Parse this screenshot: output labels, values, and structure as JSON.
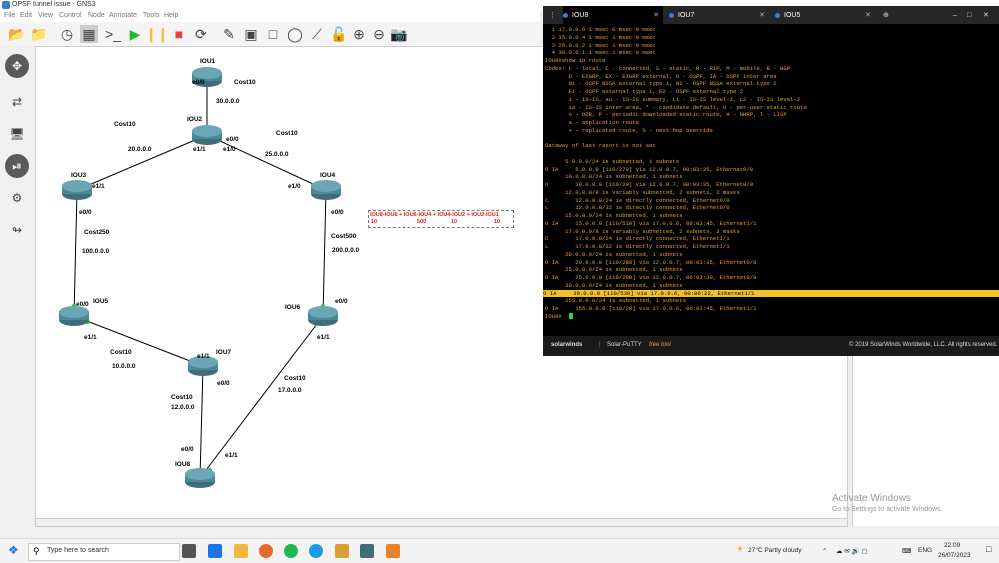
{
  "window": {
    "title": "OPSF tunnel issue - GNS3"
  },
  "menu": [
    "File",
    "Edit",
    "View",
    "Control",
    "Node",
    "Annotate",
    "Tools",
    "Help"
  ],
  "topology": {
    "routers": [
      "IOU1",
      "IOU2",
      "IOU3",
      "IOU4",
      "IOU5",
      "IOU6",
      "IOU7",
      "IOU8"
    ],
    "ports": {
      "iou1_e00": "e0/0",
      "iou2_e11": "e1/1",
      "iou2_e00": "e0/0",
      "iou2_e10": "e1/0",
      "iou3_e11": "e1/1",
      "iou3_e00": "e0/0",
      "iou4_e10": "e1/0",
      "iou4_e00": "e0/0",
      "iou5_e00": "e0/0",
      "iou5_e11": "e1/1",
      "iou6_e00": "e0/0",
      "iou6_e11": "e1/1",
      "iou7_e11": "e1/1",
      "iou7_e00": "e0/0",
      "iou8_e00": "e0/0",
      "iou8_e11": "e1/1"
    },
    "links": {
      "l1_cost": "Cost10",
      "l1_net": "30.0.0.0",
      "l2_cost": "Cost10",
      "l2_net": "20.0.0.0",
      "l3_cost": "Cost10",
      "l3_net": "25.0.0.0",
      "l4_cost": "Cost250",
      "l4_net": "100.0.0.0",
      "l5_cost": "Cost500",
      "l5_net": "200.0.0.0",
      "l6_cost": "Cost10",
      "l6_net": "10.0.0.0",
      "l7_cost": "Cost10",
      "l7_net": "12.0.0.0",
      "l8_cost": "Cost10",
      "l8_net": "17.0.0.0"
    },
    "note": {
      "line1": "IOU8-IOU6 + IOU6-IOU4 + IOU4-IOU2 + IOU2-IOU1",
      "v1": "10",
      "v2": "500",
      "v3": "10",
      "v4": "10"
    }
  },
  "terminal": {
    "tabs": [
      "IOU8",
      "IOU7",
      "IOU5"
    ],
    "lines": [
      "  1 17.0.0.6 1 msec 0 msec 0 msec",
      "  2 15.0.0.4 1 msec 1 msec 0 msec",
      "  3 25.0.0.2 1 msec 1 msec 0 msec",
      "  4 30.0.0.1 1 msec 1 msec 0 msec",
      "IOU8#show ip route",
      "Codes: L - local, C - connected, S - static, R - RIP, M - mobile, B - BGP",
      "       D - EIGRP, EX - EIGRP external, O - OSPF, IA - OSPF inter area",
      "       N1 - OSPF NSSA external type 1, N2 - OSPF NSSA external type 2",
      "       E1 - OSPF external type 1, E2 - OSPF external type 2",
      "       i - IS-IS, su - IS-IS summary, L1 - IS-IS level-1, L2 - IS-IS level-2",
      "       ia - IS-IS inter area, * - candidate default, U - per-user static route",
      "       o - ODR, P - periodic downloaded static route, H - NHRP, l - LISP",
      "       a - application route",
      "       + - replicated route, % - next hop override",
      "",
      "Gateway of last resort is not set",
      "",
      "      5.0.0.0/24 is subnetted, 1 subnets",
      "O IA     5.0.0.0 [110/270] via 12.0.0.7, 00:03:35, Ethernet0/0",
      "      10.0.0.0/24 is subnetted, 1 subnets",
      "O        10.0.0.0 [110/20] via 12.0.0.7, 00:03:35, Ethernet0/0",
      "      12.0.0.0/8 is variably subnetted, 2 subnets, 2 masks",
      "C        12.0.0.0/24 is directly connected, Ethernet0/0",
      "L        12.0.0.8/32 is directly connected, Ethernet0/0",
      "      15.0.0.0/24 is subnetted, 1 subnets",
      "O IA     15.0.0.0 [110/510] via 17.0.0.6, 00:03:45, Ethernet1/1",
      "      17.0.0.0/8 is variably subnetted, 2 subnets, 2 masks",
      "C        17.0.0.0/24 is directly connected, Ethernet1/1",
      "L        17.0.0.8/32 is directly connected, Ethernet1/1",
      "      20.0.0.0/24 is subnetted, 1 subnets",
      "O IA     20.0.0.0 [110/280] via 12.0.0.7, 00:03:35, Ethernet0/0",
      "      25.0.0.0/24 is subnetted, 1 subnets",
      "O IA     25.0.0.0 [110/290] via 12.0.0.7, 00:03:30, Ethernet0/0",
      "      30.0.0.0/24 is subnetted, 1 subnets",
      "O IA     30.0.0.0 [110/530] via 17.0.0.6, 00:00:22, Ethernet1/1",
      "      155.0.0.0/24 is subnetted, 1 subnets",
      "O IA     155.0.0.0 [110/20] via 17.0.0.6, 00:03:45, Ethernet1/1",
      "IOU8#"
    ],
    "highlight_index": 34,
    "status_brand": "solarwinds",
    "status_product": "Solar-PuTTY",
    "status_free": "free tool",
    "status_copyright": "© 2019 SolarWinds Worldwide, LLC. All rights reserved."
  },
  "watermark": {
    "line1": "Activate Windows",
    "line2": "Go to Settings to activate Windows."
  },
  "taskbar": {
    "search_placeholder": "Type here to search",
    "weather": "27°C  Partly cloudy",
    "lang": "ENG",
    "time": "22:09",
    "date": "26/07/2023"
  },
  "colors": {
    "terminal_text": "#e8a030",
    "highlight": "#f2c027",
    "link": "#000000",
    "port_dot": "#22cc22"
  }
}
